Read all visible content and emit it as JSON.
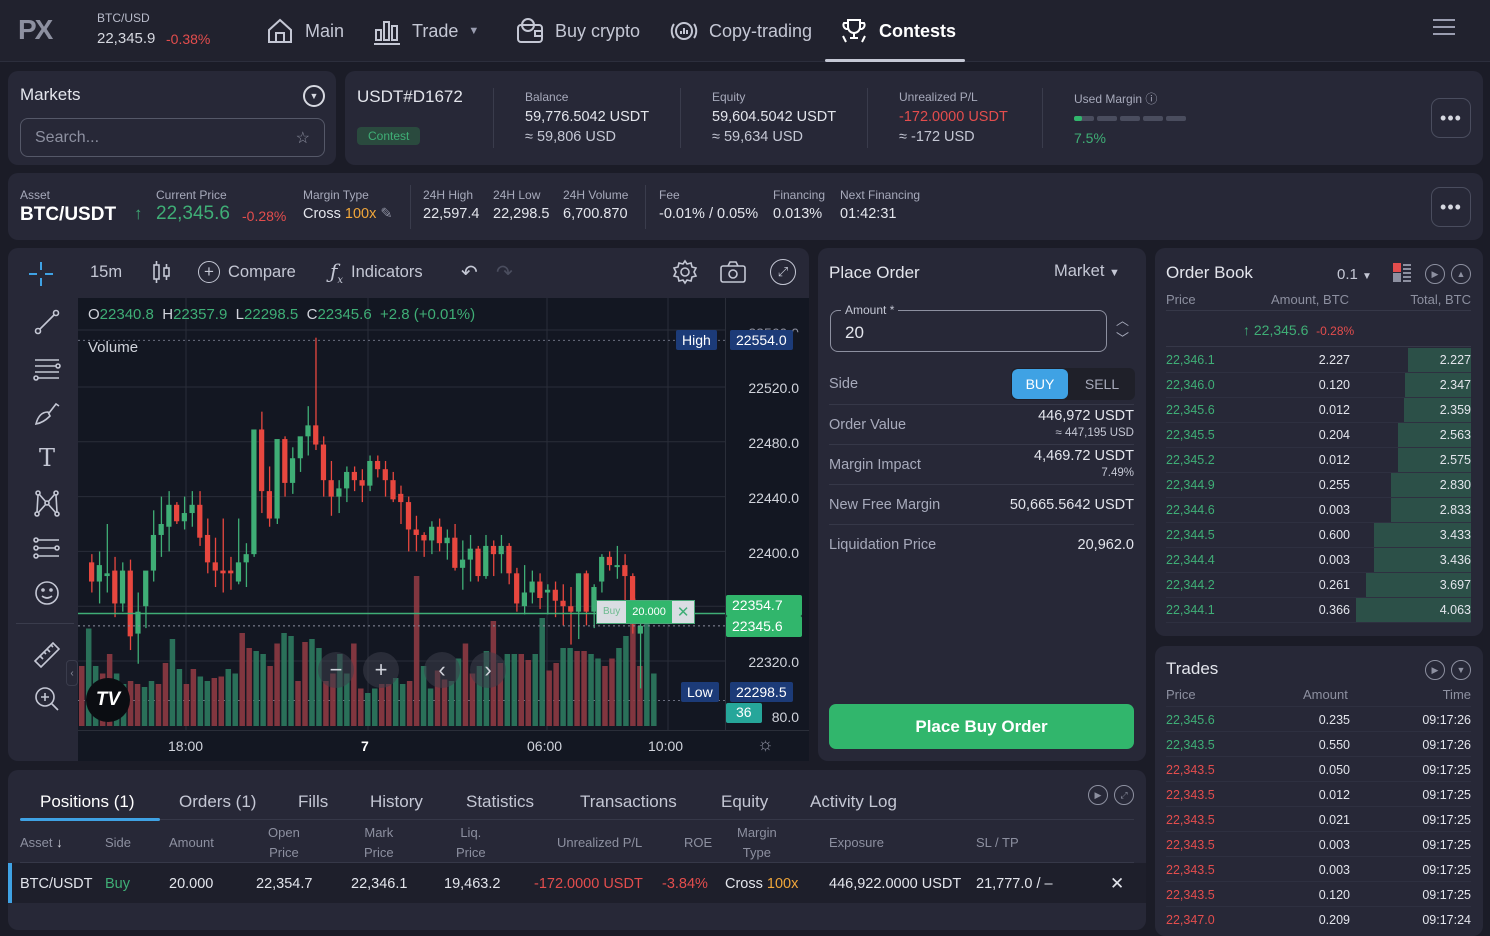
{
  "topnav": {
    "logo": "PX",
    "ticker": {
      "symbol": "BTC/USD",
      "price": "22,345.9",
      "change": "-0.38%"
    },
    "items": [
      {
        "label": "Main",
        "icon": "home-icon"
      },
      {
        "label": "Trade",
        "icon": "bar-chart-icon",
        "dropdown": true
      },
      {
        "label": "Buy crypto",
        "icon": "wallet-bitcoin-icon"
      },
      {
        "label": "Copy-trading",
        "icon": "copy-trading-icon"
      },
      {
        "label": "Contests",
        "icon": "trophy-icon",
        "active": true
      }
    ]
  },
  "markets": {
    "title": "Markets",
    "search_placeholder": "Search..."
  },
  "account": {
    "id": "USDT#D1672",
    "badge": "Contest",
    "balance": {
      "label": "Balance",
      "value": "59,776.5042 USDT",
      "approx": "≈ 59,806 USD"
    },
    "equity": {
      "label": "Equity",
      "value": "59,604.5042 USDT",
      "approx": "≈ 59,634 USD"
    },
    "unrealized": {
      "label": "Unrealized P/L",
      "value": "-172.0000 USDT",
      "approx": "≈ -172 USD"
    },
    "used_margin": {
      "label": "Used Margin",
      "value": "7.5%",
      "fraction": 0.075,
      "segments": 5
    }
  },
  "asset_bar": {
    "asset": {
      "label": "Asset",
      "value": "BTC/USDT"
    },
    "current_price": {
      "label": "Current Price",
      "value": "22,345.6",
      "change": "-0.28%"
    },
    "margin_type": {
      "label": "Margin Type",
      "mode": "Cross",
      "leverage": "100x"
    },
    "high": {
      "label": "24H High",
      "value": "22,597.4"
    },
    "low": {
      "label": "24H Low",
      "value": "22,298.5"
    },
    "volume": {
      "label": "24H Volume",
      "value": "6,700.870"
    },
    "fee": {
      "label": "Fee",
      "value": "-0.01% / 0.05%"
    },
    "financing": {
      "label": "Financing",
      "value": "0.013%"
    },
    "next_financing": {
      "label": "Next Financing",
      "value": "01:42:31"
    }
  },
  "chart_toolbar": {
    "interval": "15m",
    "compare": "Compare",
    "indicators": "Indicators"
  },
  "chart_data": {
    "type": "candlestick",
    "symbol": "BTC/USDT",
    "interval": "15m",
    "ohlc_legend": {
      "O": "22340.8",
      "H": "22357.9",
      "L": "22298.5",
      "C": "22345.6",
      "change": "+2.8 (+0.01%)"
    },
    "volume_label": "Volume",
    "y_ticks": [
      "22520.0",
      "22480.0",
      "22440.0",
      "22400.0",
      "22320.0",
      "80.0"
    ],
    "y_top_partial": "22560.0",
    "x_ticks": [
      "18:00",
      "7",
      "06:00",
      "10:00"
    ],
    "ylim": [
      22280,
      22560
    ],
    "markers": {
      "high": {
        "label": "High",
        "value": "22554.0"
      },
      "low": {
        "label": "Low",
        "value": "22298.5"
      },
      "open_position": "22354.7",
      "last_price": "22345.6",
      "countdown": "36"
    },
    "position_line": {
      "side": "Buy",
      "amount": "20.000"
    },
    "candles": [
      [
        22392,
        22398,
        22370,
        22378
      ],
      [
        22378,
        22400,
        22362,
        22390
      ],
      [
        22382,
        22420,
        22370,
        22384
      ],
      [
        22386,
        22396,
        22352,
        22362
      ],
      [
        22362,
        22392,
        22356,
        22386
      ],
      [
        22386,
        22394,
        22328,
        22338
      ],
      [
        22340,
        22370,
        22318,
        22356
      ],
      [
        22360,
        22384,
        22344,
        22386
      ],
      [
        22386,
        22430,
        22378,
        22412
      ],
      [
        22412,
        22440,
        22396,
        22420
      ],
      [
        22418,
        22444,
        22400,
        22434
      ],
      [
        22434,
        22436,
        22420,
        22422
      ],
      [
        22422,
        22440,
        22416,
        22428
      ],
      [
        22428,
        22444,
        22418,
        22434
      ],
      [
        22434,
        22444,
        22404,
        22410
      ],
      [
        22412,
        22424,
        22384,
        22392
      ],
      [
        22392,
        22410,
        22374,
        22386
      ],
      [
        22386,
        22424,
        22370,
        22384
      ],
      [
        22386,
        22396,
        22372,
        22384
      ],
      [
        22378,
        22424,
        22376,
        22392
      ],
      [
        22392,
        22406,
        22374,
        22398
      ],
      [
        22398,
        22486,
        22396,
        22489
      ],
      [
        22489,
        22502,
        22428,
        22444
      ],
      [
        22444,
        22462,
        22418,
        22424
      ],
      [
        22424,
        22464,
        22420,
        22482
      ],
      [
        22482,
        22484,
        22440,
        22450
      ],
      [
        22450,
        22476,
        22442,
        22468
      ],
      [
        22468,
        22480,
        22458,
        22484
      ],
      [
        22484,
        22506,
        22470,
        22492
      ],
      [
        22492,
        22556,
        22474,
        22478
      ],
      [
        22478,
        22484,
        22440,
        22452
      ],
      [
        22452,
        22466,
        22426,
        22440
      ],
      [
        22440,
        22452,
        22428,
        22446
      ],
      [
        22446,
        22462,
        22436,
        22458
      ],
      [
        22458,
        22462,
        22444,
        22452
      ],
      [
        22452,
        22460,
        22436,
        22448
      ],
      [
        22448,
        22470,
        22444,
        22466
      ],
      [
        22466,
        22470,
        22454,
        22460
      ],
      [
        22460,
        22466,
        22440,
        22452
      ],
      [
        22452,
        22458,
        22436,
        22438
      ],
      [
        22442,
        22448,
        22420,
        22436
      ],
      [
        22436,
        22440,
        22400,
        22416
      ],
      [
        22416,
        22426,
        22400,
        22412
      ],
      [
        22412,
        22414,
        22396,
        22408
      ],
      [
        22408,
        22422,
        22398,
        22418
      ],
      [
        22418,
        22424,
        22400,
        22406
      ],
      [
        22406,
        22416,
        22394,
        22410
      ],
      [
        22410,
        22420,
        22386,
        22388
      ],
      [
        22388,
        22408,
        22372,
        22394
      ],
      [
        22394,
        22412,
        22378,
        22402
      ],
      [
        22402,
        22404,
        22378,
        22382
      ],
      [
        22382,
        22412,
        22380,
        22404
      ],
      [
        22404,
        22408,
        22382,
        22398
      ],
      [
        22398,
        22412,
        22384,
        22404
      ],
      [
        22404,
        22406,
        22376,
        22384
      ],
      [
        22384,
        22388,
        22356,
        22362
      ],
      [
        22360,
        22390,
        22354,
        22370
      ],
      [
        22370,
        22386,
        22362,
        22378
      ],
      [
        22378,
        22384,
        22358,
        22366
      ],
      [
        22370,
        22376,
        22354,
        22372
      ],
      [
        22372,
        22378,
        22352,
        22364
      ],
      [
        22364,
        22376,
        22346,
        22360
      ],
      [
        22360,
        22374,
        22332,
        22356
      ],
      [
        22356,
        22384,
        22336,
        22384
      ],
      [
        22384,
        22386,
        22346,
        22356
      ],
      [
        22356,
        22376,
        22344,
        22374
      ],
      [
        22378,
        22398,
        22370,
        22396
      ],
      [
        22396,
        22400,
        22386,
        22390
      ],
      [
        22390,
        22404,
        22380,
        22390
      ],
      [
        22390,
        22398,
        22360,
        22382
      ],
      [
        22382,
        22384,
        22340,
        22358
      ],
      [
        22340,
        22360,
        22300,
        22345.6
      ]
    ],
    "volumes": [
      0.4,
      0.65,
      0.4,
      0.35,
      0.48,
      0.35,
      0.28,
      0.3,
      0.28,
      0.26,
      0.3,
      0.28,
      0.42,
      0.58,
      0.38,
      0.28,
      0.38,
      0.33,
      0.3,
      0.32,
      0.33,
      0.38,
      0.35,
      0.62,
      0.52,
      0.5,
      0.48,
      0.4,
      0.55,
      0.62,
      0.6,
      0.3,
      0.56,
      0.58,
      0.52,
      0.3,
      0.35,
      0.48,
      0.35,
      0.55,
      0.25,
      0.22,
      0.25,
      0.28,
      0.28,
      0.32,
      0.28,
      0.3,
      1.0,
      0.4,
      0.25,
      0.37,
      0.31,
      0.3,
      0.45,
      0.55,
      0.35,
      0.4,
      0.5,
      0.7,
      0.42,
      0.48,
      0.48,
      0.48,
      0.44,
      0.48,
      0.72,
      0.37,
      0.42,
      0.52,
      0.52,
      0.5,
      0.5,
      0.48,
      0.45,
      0.4,
      0.45,
      0.52,
      0.6,
      0.85,
      0.4,
      0.7,
      0.35
    ]
  },
  "place_order": {
    "title": "Place Order",
    "order_type": "Market",
    "amount_label": "Amount *",
    "amount_value": "20",
    "side_label": "Side",
    "buy": "BUY",
    "sell": "SELL",
    "rows": [
      {
        "label": "Order Value",
        "value": "446,972 USDT",
        "sub": "≈ 447,195 USD"
      },
      {
        "label": "Margin Impact",
        "value": "4,469.72 USDT",
        "sub": "7.49%"
      },
      {
        "label": "New Free Margin",
        "value": "50,665.5642 USDT"
      },
      {
        "label": "Liquidation Price",
        "value": "20,962.0"
      }
    ],
    "submit": "Place Buy Order"
  },
  "order_book": {
    "title": "Order Book",
    "precision": "0.1",
    "headers": [
      "Price",
      "Amount, BTC",
      "Total, BTC"
    ],
    "last_price": "22,345.6",
    "last_change": "-0.28%",
    "rows": [
      {
        "price": "22,346.1",
        "amount": "2.227",
        "total": "2.227"
      },
      {
        "price": "22,346.0",
        "amount": "0.120",
        "total": "2.347"
      },
      {
        "price": "22,345.6",
        "amount": "0.012",
        "total": "2.359"
      },
      {
        "price": "22,345.5",
        "amount": "0.204",
        "total": "2.563"
      },
      {
        "price": "22,345.2",
        "amount": "0.012",
        "total": "2.575"
      },
      {
        "price": "22,344.9",
        "amount": "0.255",
        "total": "2.830"
      },
      {
        "price": "22,344.6",
        "amount": "0.003",
        "total": "2.833"
      },
      {
        "price": "22,344.5",
        "amount": "0.600",
        "total": "3.433"
      },
      {
        "price": "22,344.4",
        "amount": "0.003",
        "total": "3.436"
      },
      {
        "price": "22,344.2",
        "amount": "0.261",
        "total": "3.697"
      },
      {
        "price": "22,344.1",
        "amount": "0.366",
        "total": "4.063"
      }
    ]
  },
  "trades": {
    "title": "Trades",
    "headers": [
      "Price",
      "Amount",
      "Time"
    ],
    "rows": [
      {
        "price": "22,345.6",
        "amount": "0.235",
        "time": "09:17:26",
        "side": "buy"
      },
      {
        "price": "22,343.5",
        "amount": "0.550",
        "time": "09:17:26",
        "side": "buy"
      },
      {
        "price": "22,343.5",
        "amount": "0.050",
        "time": "09:17:25",
        "side": "sell"
      },
      {
        "price": "22,343.5",
        "amount": "0.012",
        "time": "09:17:25",
        "side": "sell"
      },
      {
        "price": "22,343.5",
        "amount": "0.021",
        "time": "09:17:25",
        "side": "sell"
      },
      {
        "price": "22,343.5",
        "amount": "0.003",
        "time": "09:17:25",
        "side": "sell"
      },
      {
        "price": "22,343.5",
        "amount": "0.003",
        "time": "09:17:25",
        "side": "sell"
      },
      {
        "price": "22,343.5",
        "amount": "0.120",
        "time": "09:17:25",
        "side": "sell"
      },
      {
        "price": "22,347.0",
        "amount": "0.209",
        "time": "09:17:24",
        "side": "sell"
      }
    ]
  },
  "bottom": {
    "tabs": [
      "Positions (1)",
      "Orders (1)",
      "Fills",
      "History",
      "Statistics",
      "Transactions",
      "Equity",
      "Activity Log"
    ],
    "active_tab": 0,
    "headers": [
      "Asset",
      "Side",
      "Amount",
      "Open\nPrice",
      "Mark\nPrice",
      "Liq.\nPrice",
      "Unrealized P/L",
      "ROE",
      "Margin\nType",
      "Exposure",
      "SL / TP"
    ],
    "position": {
      "asset": "BTC/USDT",
      "side": "Buy",
      "amount": "20.000",
      "open_price": "22,354.7",
      "mark_price": "22,346.1",
      "liq_price": "19,463.2",
      "unrealized": "-172.0000 USDT",
      "roe": "-3.84%",
      "margin_mode": "Cross",
      "leverage": "100x",
      "exposure": "446,922.0000 USDT",
      "sl_tp": "21,777.0 / –"
    }
  }
}
